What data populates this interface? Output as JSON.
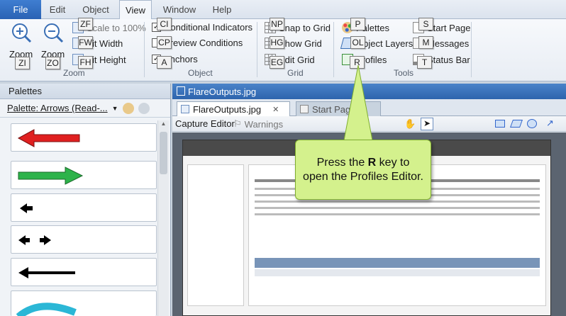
{
  "menu": {
    "file": "File",
    "edit": "Edit",
    "object": "Object",
    "view": "View",
    "window": "Window",
    "help": "Help"
  },
  "ribbon": {
    "zoom_group": {
      "label": "Zoom",
      "zoom_in": "Zoom",
      "zoom_in_key": "ZI",
      "zoom_out": "Zoom",
      "zoom_out_key": "ZO",
      "scale_100": "Scale to 100%",
      "scale_100_key": "ZF",
      "fit_width": "Fit Width",
      "fit_width_key": "FW",
      "fit_height": "Fit Height",
      "fit_height_key": "FH"
    },
    "object_group": {
      "label": "Object",
      "conditional": "Conditional Indicators",
      "conditional_key": "CI",
      "preview": "Preview Conditions",
      "preview_key": "CP",
      "anchors": "Anchors",
      "anchors_key": "A"
    },
    "grid_group": {
      "label": "Grid",
      "snap": "Snap to Grid",
      "snap_key": "NP",
      "show": "Show Grid",
      "show_key": "HG",
      "edit": "Edit Grid",
      "edit_key": "EG"
    },
    "tools_group": {
      "label": "Tools",
      "palettes": "Palettes",
      "palettes_key": "P",
      "object_layers": "Object Layers",
      "object_layers_key": "OL",
      "profiles": "Profiles",
      "profiles_key": "R",
      "start_page": "Start Page",
      "start_page_key": "S",
      "messages": "Messages",
      "messages_key": "M",
      "status_bar": "Status Bar",
      "status_bar_key": "T"
    }
  },
  "palettes_panel": {
    "title": "Palettes",
    "selector": "Palette: Arrows (Read-..."
  },
  "document": {
    "window_title": "FlareOutputs.jpg",
    "tabs": [
      {
        "label": "FlareOutputs.jpg",
        "active": true
      },
      {
        "label": "Start Page",
        "active": false
      }
    ],
    "toolbar": {
      "capture_editor": "Capture Editor",
      "warnings": "Warnings"
    }
  },
  "callout": {
    "prefix": "Press the ",
    "key": "R",
    "suffix": " key to open the Profiles Editor."
  },
  "colors": {
    "accent": "#2d64ad",
    "callout_fill": "#d4f18d",
    "callout_border": "#7fae2e",
    "arrow_red": "#e02020",
    "arrow_green": "#2db34a"
  }
}
